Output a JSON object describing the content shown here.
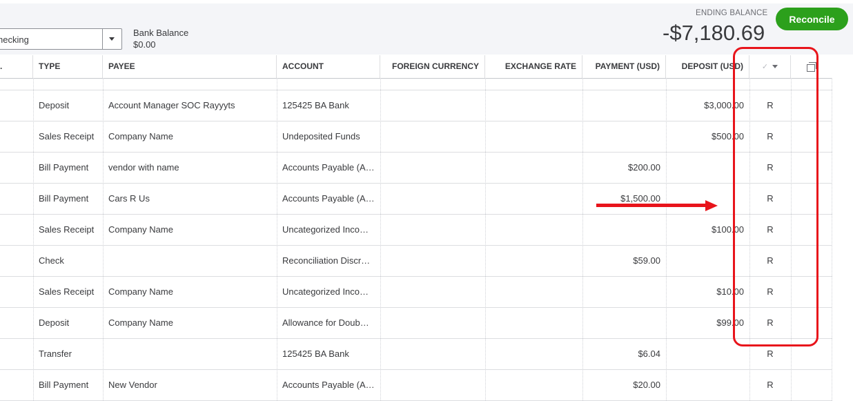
{
  "header": {
    "account_value": "hecking",
    "bank_balance_label": "Bank Balance",
    "bank_balance_value": "$0.00",
    "ending_balance_label": "ENDING BALANCE",
    "ending_balance_value": "-$7,180.69",
    "reconcile_label": "Reconcile"
  },
  "columns": {
    "no": ".",
    "type": "TYPE",
    "payee": "PAYEE",
    "account": "ACCOUNT",
    "foreign_currency": "FOREIGN CURRENCY",
    "exchange_rate": "EXCHANGE RATE",
    "payment": "PAYMENT (USD)",
    "deposit": "DEPOSIT (USD)",
    "reconcile_status": "✓"
  },
  "rows": [
    {
      "type": "Deposit",
      "payee": "Account Manager SOC Rayyyts",
      "account": "125425 BA Bank",
      "payment": "",
      "deposit": "$3,000.00",
      "status": "R"
    },
    {
      "type": "Sales Receipt",
      "payee": "Company Name",
      "account": "Undeposited Funds",
      "payment": "",
      "deposit": "$500.00",
      "status": "R"
    },
    {
      "type": "Bill Payment",
      "payee": "vendor with name",
      "account": "Accounts Payable (A…",
      "payment": "$200.00",
      "deposit": "",
      "status": "R"
    },
    {
      "type": "Bill Payment",
      "payee": "Cars R Us",
      "account": "Accounts Payable (A…",
      "payment": "$1,500.00",
      "deposit": "",
      "status": "R"
    },
    {
      "type": "Sales Receipt",
      "payee": "Company Name",
      "account": "Uncategorized Inco…",
      "payment": "",
      "deposit": "$100.00",
      "status": "R"
    },
    {
      "type": "Check",
      "payee": "",
      "account": "Reconciliation Discr…",
      "payment": "$59.00",
      "deposit": "",
      "status": "R"
    },
    {
      "type": "Sales Receipt",
      "payee": "Company Name",
      "account": "Uncategorized Inco…",
      "payment": "",
      "deposit": "$10.00",
      "status": "R"
    },
    {
      "type": "Deposit",
      "payee": "Company Name",
      "account": "Allowance for Doub…",
      "payment": "",
      "deposit": "$99.00",
      "status": "R"
    },
    {
      "type": "Transfer",
      "payee": "",
      "account": "125425 BA Bank",
      "payment": "$6.04",
      "deposit": "",
      "status": "R"
    },
    {
      "type": "Bill Payment",
      "payee": "New Vendor",
      "account": "Accounts Payable (A…",
      "payment": "$20.00",
      "deposit": "",
      "status": "R"
    }
  ],
  "annotation_color": "#e8141b",
  "brand_green": "#2ca01c"
}
